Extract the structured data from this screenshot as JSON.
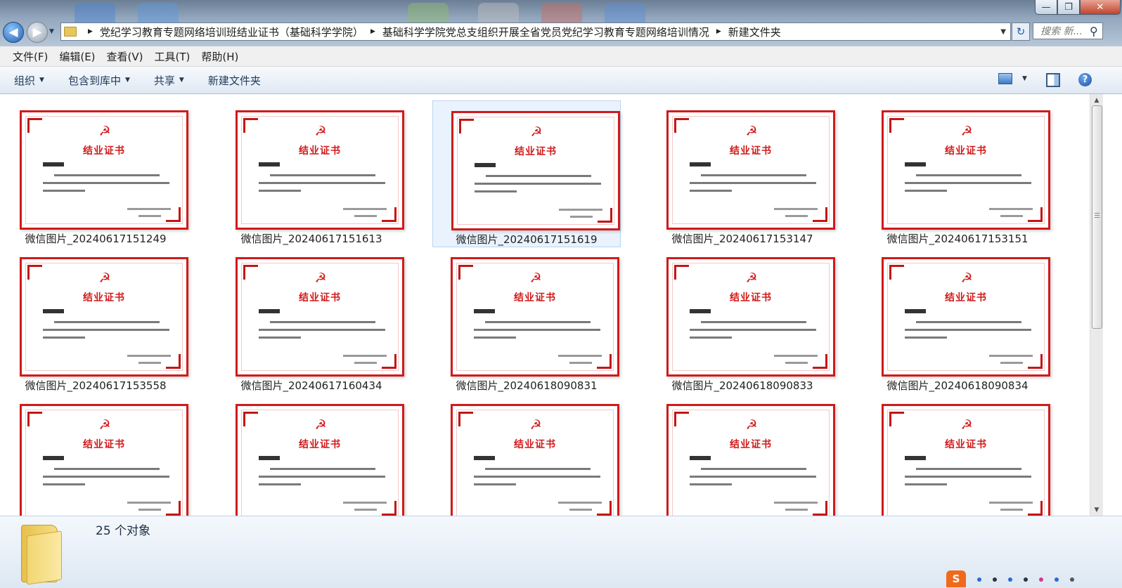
{
  "window": {
    "controls": {
      "minimize": "—",
      "maximize": "❐",
      "close": "✕"
    }
  },
  "nav": {
    "back_icon": "◀",
    "forward_icon": "▶",
    "dropdown_icon": "▼"
  },
  "address": {
    "crumbs": [
      "党纪学习教育专题网络培训班结业证书（基础科学学院）",
      "基础科学学院党总支组织开展全省党员党纪学习教育专题网络培训情况",
      "新建文件夹"
    ],
    "separator_icon": "▶",
    "dropdown_icon": "▼",
    "refresh_icon": "↻"
  },
  "search": {
    "placeholder": "搜索 新...",
    "icon": "⚲"
  },
  "menu": [
    "文件(F)",
    "编辑(E)",
    "查看(V)",
    "工具(T)",
    "帮助(H)"
  ],
  "commands": [
    {
      "label": "组织",
      "has_arrow": true
    },
    {
      "label": "包含到库中",
      "has_arrow": true
    },
    {
      "label": "共享",
      "has_arrow": true
    },
    {
      "label": "新建文件夹",
      "has_arrow": false
    }
  ],
  "command_icons": {
    "views": "▦",
    "views_arrow": "▼",
    "preview_pane": "▯",
    "help": "?"
  },
  "certificate": {
    "title": "结业证书",
    "emblem": "☭"
  },
  "files": [
    {
      "name": "微信图片_20240617151249",
      "selected": false
    },
    {
      "name": "微信图片_20240617151613",
      "selected": false
    },
    {
      "name": "微信图片_20240617151619",
      "selected": true
    },
    {
      "name": "微信图片_20240617153147",
      "selected": false
    },
    {
      "name": "微信图片_20240617153151",
      "selected": false
    },
    {
      "name": "微信图片_20240617153558",
      "selected": false
    },
    {
      "name": "微信图片_20240617160434",
      "selected": false
    },
    {
      "name": "微信图片_20240618090831",
      "selected": false
    },
    {
      "name": "微信图片_20240618090833",
      "selected": false
    },
    {
      "name": "微信图片_20240618090834",
      "selected": false
    },
    {
      "name": "",
      "selected": false
    },
    {
      "name": "",
      "selected": false
    },
    {
      "name": "",
      "selected": false
    },
    {
      "name": "",
      "selected": false
    },
    {
      "name": "",
      "selected": false
    }
  ],
  "scrollbar": {
    "up": "▲",
    "down": "▼"
  },
  "status": {
    "count_text": "25 个对象"
  },
  "tray": {
    "ime_label": "S"
  },
  "colors": {
    "accent_red": "#d11a1a",
    "command_text": "#1e395b",
    "selection": "#eaf3fd"
  }
}
